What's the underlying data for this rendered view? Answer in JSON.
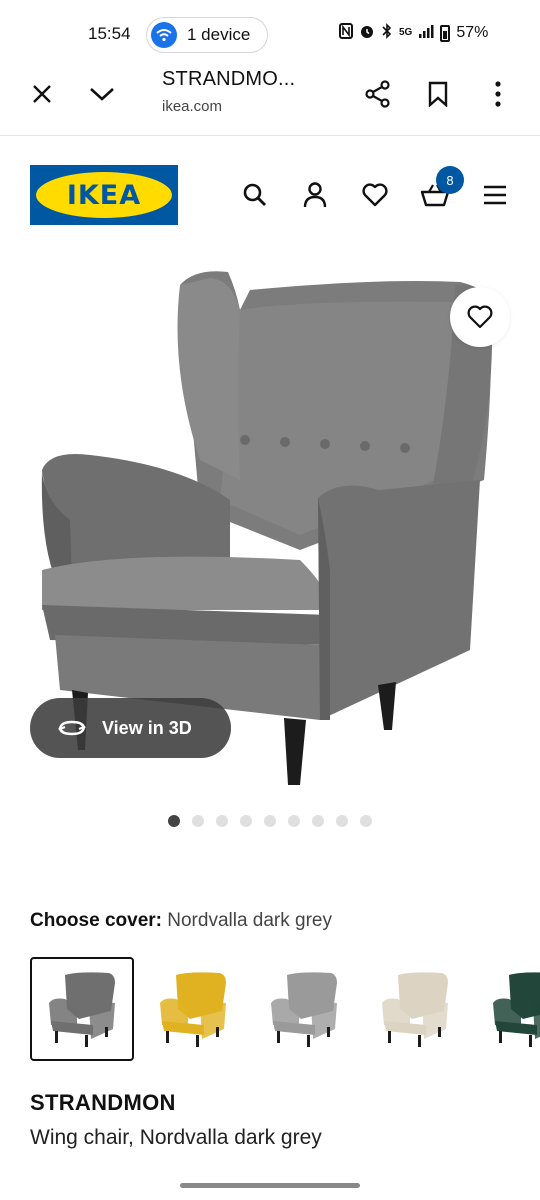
{
  "status_bar": {
    "time": "15:54",
    "device_pill_label": "1 device",
    "network": "5G",
    "battery": "57%"
  },
  "browser": {
    "page_title": "STRANDMO...",
    "domain": "ikea.com",
    "icons": [
      "close-icon",
      "chevron-down-icon",
      "share-icon",
      "bookmark-icon",
      "more-vert-icon"
    ]
  },
  "header": {
    "logo_text": "IKEA",
    "cart_count": "8",
    "icons": [
      "search-icon",
      "user-icon",
      "heart-icon",
      "basket-icon",
      "menu-icon"
    ]
  },
  "gallery": {
    "view_3d_label": "View in 3D",
    "image_count": 9,
    "active_index": 0
  },
  "cover": {
    "label": "Choose cover:",
    "value": "Nordvalla dark grey",
    "options": [
      {
        "color": "#6f6f6f",
        "selected": true
      },
      {
        "color": "#e0b222",
        "selected": false
      },
      {
        "color": "#9a9a9a",
        "selected": false
      },
      {
        "color": "#dcd3c2",
        "selected": false
      },
      {
        "color": "#22463a",
        "selected": false
      }
    ]
  },
  "product": {
    "name": "STRANDMON",
    "description": "Wing chair, Nordvalla dark grey"
  },
  "colors": {
    "ikea_blue": "#0058a3",
    "ikea_yellow": "#ffdb00",
    "chair_grey": "#7a7a7a"
  }
}
